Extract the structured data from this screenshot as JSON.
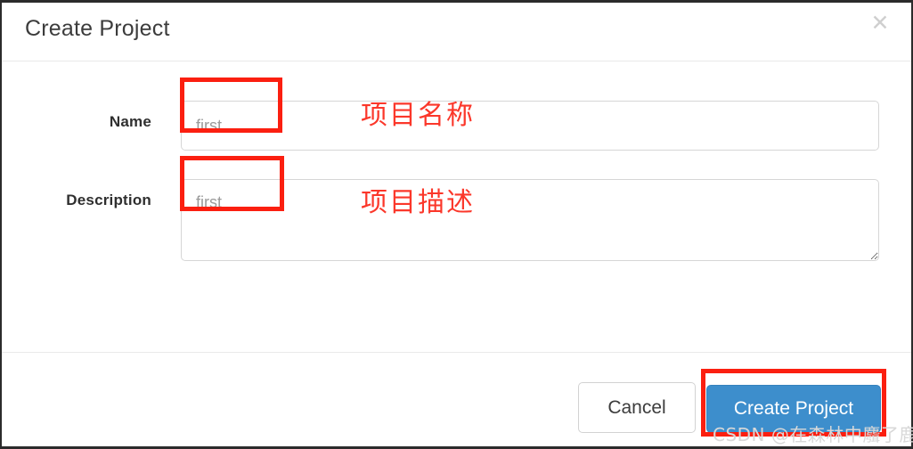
{
  "dialog": {
    "title": "Create Project",
    "close_icon": "close-icon",
    "close_glyph": "✕"
  },
  "form": {
    "fields": [
      {
        "label": "Name",
        "type": "input",
        "value": "",
        "placeholder": "first",
        "annotation": "项目名称"
      },
      {
        "label": "Description",
        "type": "textarea",
        "value": "",
        "placeholder": "first",
        "annotation": "项目描述"
      }
    ]
  },
  "footer": {
    "cancel_label": "Cancel",
    "create_label": "Create Project"
  },
  "watermark": {
    "text": "CSDN @在森林中麛了鹿"
  },
  "colors": {
    "annotation_red": "#fb1f10",
    "annotation_text_red": "#fb372a",
    "primary_blue": "#3d8ecc",
    "border_gray": "#d6d6d6",
    "divider_gray": "#e9e9e9",
    "placeholder_gray": "#9b9b9b",
    "title_text": "#3c3c3c",
    "watermark_gray": "#d8d8d8"
  }
}
